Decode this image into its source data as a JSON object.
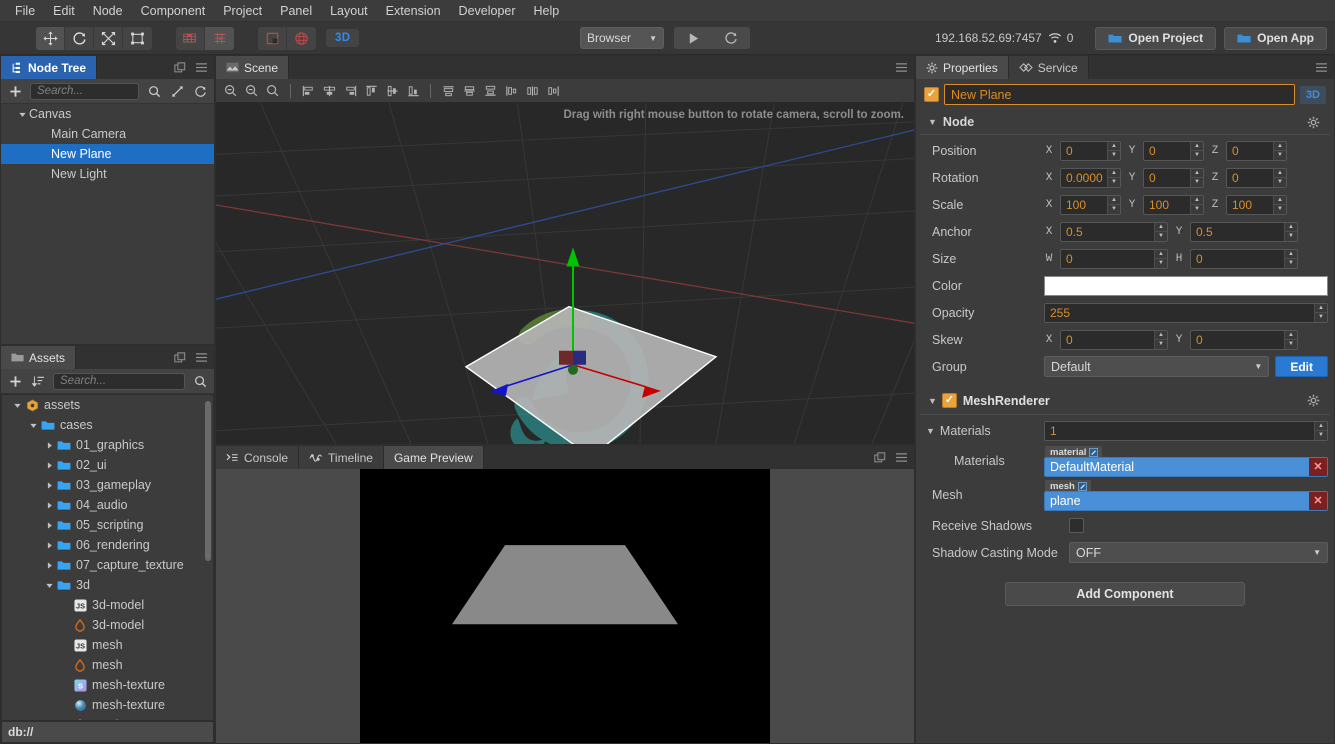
{
  "menubar": {
    "items": [
      "File",
      "Edit",
      "Node",
      "Component",
      "Project",
      "Panel",
      "Layout",
      "Extension",
      "Developer",
      "Help"
    ]
  },
  "toolbar": {
    "transform_tools": [
      {
        "name": "move-tool",
        "label": "Move"
      },
      {
        "name": "rotate-tool",
        "label": "Rotate"
      },
      {
        "name": "scale-tool",
        "label": "Scale"
      },
      {
        "name": "rect-tool",
        "label": "Rect"
      }
    ],
    "align_tools": [
      {
        "name": "pivot-tool",
        "label": "Pivot"
      },
      {
        "name": "center-tool",
        "label": "Center"
      }
    ],
    "coord_tools": [
      {
        "name": "local-coord-tool",
        "label": "Local"
      },
      {
        "name": "global-coord-tool",
        "label": "Global"
      }
    ],
    "dimension_badge": "3D",
    "preview_target": "Browser",
    "play_label": "Play",
    "refresh_label": "Refresh",
    "device_address": "192.168.52.69:7457",
    "connection_count": "0",
    "open_project_label": "Open Project",
    "open_app_label": "Open App"
  },
  "node_tree": {
    "tab_label": "Node Tree",
    "search_placeholder": "Search...",
    "add_label": "+",
    "items": [
      {
        "label": "Canvas",
        "depth": 0,
        "arrow": "down",
        "selected": false
      },
      {
        "label": "Main Camera",
        "depth": 1,
        "arrow": "none",
        "selected": false
      },
      {
        "label": "New Plane",
        "depth": 1,
        "arrow": "none",
        "selected": true
      },
      {
        "label": "New Light",
        "depth": 1,
        "arrow": "none",
        "selected": false
      }
    ]
  },
  "assets": {
    "tab_label": "Assets",
    "search_placeholder": "Search...",
    "status_path": "db://",
    "items": [
      {
        "label": "assets",
        "depth": 0,
        "arrow": "down",
        "icon": "db-icon"
      },
      {
        "label": "cases",
        "depth": 1,
        "arrow": "down",
        "icon": "folder-icon"
      },
      {
        "label": "01_graphics",
        "depth": 2,
        "arrow": "right",
        "icon": "folder-icon"
      },
      {
        "label": "02_ui",
        "depth": 2,
        "arrow": "right",
        "icon": "folder-icon"
      },
      {
        "label": "03_gameplay",
        "depth": 2,
        "arrow": "right",
        "icon": "folder-icon"
      },
      {
        "label": "04_audio",
        "depth": 2,
        "arrow": "right",
        "icon": "folder-icon"
      },
      {
        "label": "05_scripting",
        "depth": 2,
        "arrow": "right",
        "icon": "folder-icon"
      },
      {
        "label": "06_rendering",
        "depth": 2,
        "arrow": "right",
        "icon": "folder-icon"
      },
      {
        "label": "07_capture_texture",
        "depth": 2,
        "arrow": "right",
        "icon": "folder-icon"
      },
      {
        "label": "3d",
        "depth": 2,
        "arrow": "down",
        "icon": "folder-icon"
      },
      {
        "label": "3d-model",
        "depth": 3,
        "arrow": "none",
        "icon": "js-icon"
      },
      {
        "label": "3d-model",
        "depth": 3,
        "arrow": "none",
        "icon": "fire-icon"
      },
      {
        "label": "mesh",
        "depth": 3,
        "arrow": "none",
        "icon": "js-icon"
      },
      {
        "label": "mesh",
        "depth": 3,
        "arrow": "none",
        "icon": "fire-icon"
      },
      {
        "label": "mesh-texture",
        "depth": 3,
        "arrow": "none",
        "icon": "scene-icon"
      },
      {
        "label": "mesh-texture",
        "depth": 3,
        "arrow": "none",
        "icon": "sphere-icon"
      },
      {
        "label": "mesh-texture",
        "depth": 3,
        "arrow": "none",
        "icon": "fire-icon"
      }
    ]
  },
  "scene": {
    "tab_label": "Scene",
    "hint": "Drag with right mouse button to rotate camera, scroll to zoom."
  },
  "bottom": {
    "tabs": [
      {
        "label": "Console",
        "icon": "console-icon",
        "active": false
      },
      {
        "label": "Timeline",
        "icon": "timeline-icon",
        "active": false
      },
      {
        "label": "Game Preview",
        "icon": "none",
        "active": true
      }
    ]
  },
  "properties": {
    "tabs": [
      {
        "label": "Properties",
        "icon": "gear-icon",
        "active": true
      },
      {
        "label": "Service",
        "icon": "service-icon",
        "active": false
      }
    ],
    "node_enabled": true,
    "node_name": "New Plane",
    "dimension_badge": "3D",
    "node_section": {
      "title": "Node",
      "rows": [
        {
          "label": "Position",
          "type": "vec3",
          "axes": [
            "X",
            "Y",
            "Z"
          ],
          "values": [
            "0",
            "0",
            "0"
          ]
        },
        {
          "label": "Rotation",
          "type": "vec3",
          "axes": [
            "X",
            "Y",
            "Z"
          ],
          "values": [
            "0.0000",
            "0",
            "0"
          ]
        },
        {
          "label": "Scale",
          "type": "vec3",
          "axes": [
            "X",
            "Y",
            "Z"
          ],
          "values": [
            "100",
            "100",
            "100"
          ]
        },
        {
          "label": "Anchor",
          "type": "vec2",
          "axes": [
            "X",
            "Y"
          ],
          "values": [
            "0.5",
            "0.5"
          ]
        },
        {
          "label": "Size",
          "type": "vec2",
          "axes": [
            "W",
            "H"
          ],
          "values": [
            "0",
            "0"
          ]
        },
        {
          "label": "Color",
          "type": "color",
          "value": "#ffffff"
        },
        {
          "label": "Opacity",
          "type": "num",
          "value": "255"
        },
        {
          "label": "Skew",
          "type": "vec2",
          "axes": [
            "X",
            "Y"
          ],
          "values": [
            "0",
            "0"
          ]
        },
        {
          "label": "Group",
          "type": "select",
          "value": "Default",
          "button": "Edit"
        }
      ]
    },
    "mesh_renderer": {
      "title": "MeshRenderer",
      "enabled": true,
      "materials_label": "Materials",
      "materials_count": "1",
      "materials_slot_label": "Materials",
      "material_tag": "material",
      "material_value": "DefaultMaterial",
      "mesh_label": "Mesh",
      "mesh_tag": "mesh",
      "mesh_value": "plane",
      "receive_shadows_label": "Receive Shadows",
      "receive_shadows_checked": false,
      "shadow_mode_label": "Shadow Casting Mode",
      "shadow_mode_value": "OFF"
    },
    "add_component_label": "Add Component"
  },
  "colors": {
    "accent_orange": "#d98e2b",
    "accent_blue": "#2a7ad4",
    "selection_blue": "#1e6fc4",
    "panel_bg": "#3c3c3c",
    "viewport_bg": "#282828"
  }
}
